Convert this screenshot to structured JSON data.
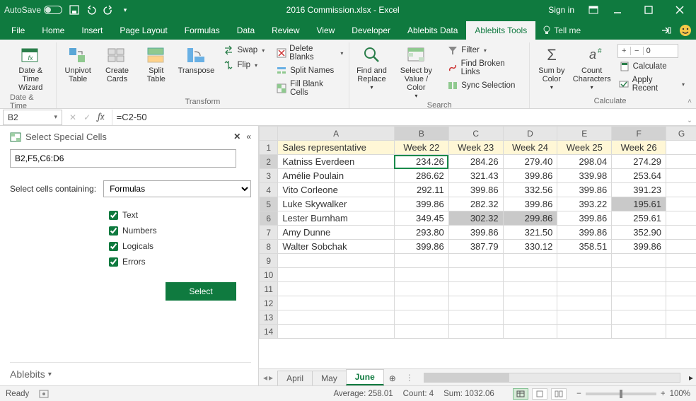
{
  "titlebar": {
    "autosave": "AutoSave",
    "title": "2016 Commission.xlsx  -  Excel",
    "signin": "Sign in"
  },
  "tabs": {
    "items": [
      "File",
      "Home",
      "Insert",
      "Page Layout",
      "Formulas",
      "Data",
      "Review",
      "View",
      "Developer",
      "Ablebits Data",
      "Ablebits Tools"
    ],
    "active_index": 10,
    "tellme": "Tell me"
  },
  "ribbon": {
    "date_time": {
      "big": "Date &\nTime Wizard",
      "group": "Date & Time"
    },
    "transform": {
      "unpivot": "Unpivot\nTable",
      "create": "Create\nCards",
      "split": "Split\nTable",
      "transpose": "Transpose",
      "swap": "Swap",
      "flip": "Flip",
      "delete": "Delete Blanks",
      "splitnames": "Split Names",
      "fill": "Fill Blank Cells",
      "group": "Transform"
    },
    "search": {
      "find": "Find and\nReplace",
      "select": "Select by\nValue / Color",
      "filter": "Filter",
      "broken": "Find Broken Links",
      "sync": "Sync Selection",
      "group": "Search"
    },
    "calculate": {
      "sum": "Sum by\nColor",
      "count": "Count\nCharacters",
      "decimal": "0",
      "calc": "Calculate",
      "apply": "Apply Recent",
      "group": "Calculate"
    }
  },
  "fbar": {
    "name": "B2",
    "formula": "=C2-50"
  },
  "pane": {
    "title": "Select Special Cells",
    "range": "B2,F5,C6:D6",
    "label": "Select cells containing:",
    "dropdown": "Formulas",
    "chk": {
      "text": "Text",
      "numbers": "Numbers",
      "logicals": "Logicals",
      "errors": "Errors"
    },
    "button": "Select",
    "footer": "Ablebits"
  },
  "grid": {
    "col_headers": [
      "A",
      "B",
      "C",
      "D",
      "E",
      "F",
      "G"
    ],
    "header_row": [
      "Sales representative",
      "Week 22",
      "Week 23",
      "Week 24",
      "Week 25",
      "Week 26"
    ],
    "rows": [
      {
        "n": "Katniss Everdeen",
        "v": [
          "234.26",
          "284.26",
          "279.40",
          "298.04",
          "274.29"
        ]
      },
      {
        "n": "Amélie Poulain",
        "v": [
          "286.62",
          "321.43",
          "399.86",
          "339.98",
          "253.64"
        ]
      },
      {
        "n": "Vito Corleone",
        "v": [
          "292.11",
          "399.86",
          "332.56",
          "399.86",
          "391.23"
        ]
      },
      {
        "n": "Luke Skywalker",
        "v": [
          "399.86",
          "282.32",
          "399.86",
          "393.22",
          "195.61"
        ]
      },
      {
        "n": "Lester Burnham",
        "v": [
          "349.45",
          "302.32",
          "299.86",
          "399.86",
          "259.61"
        ]
      },
      {
        "n": "Amy Dunne",
        "v": [
          "293.80",
          "399.86",
          "321.50",
          "399.86",
          "352.90"
        ]
      },
      {
        "n": "Walter Sobchak",
        "v": [
          "399.86",
          "387.79",
          "330.12",
          "358.51",
          "399.86"
        ]
      }
    ]
  },
  "sheets": {
    "tabs": [
      "April",
      "May",
      "June"
    ],
    "active": 2
  },
  "status": {
    "ready": "Ready",
    "average": "Average: 258.01",
    "count": "Count: 4",
    "sum": "Sum: 1032.06",
    "zoom": "100%"
  }
}
